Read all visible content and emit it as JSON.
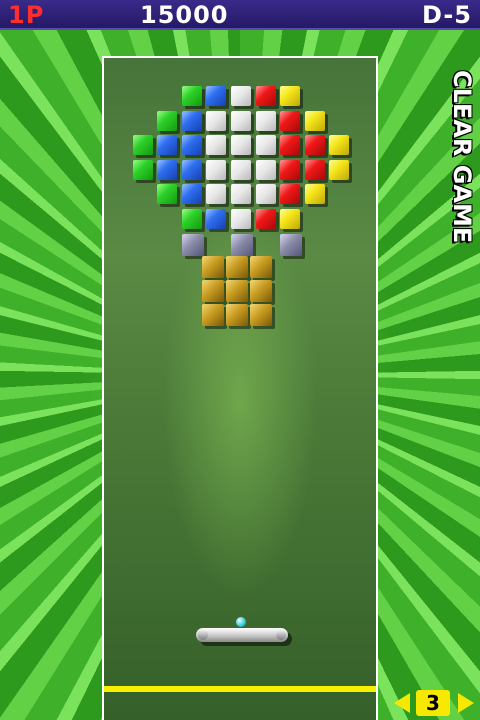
{
  "hud": {
    "player": "1P",
    "score": "15000",
    "stage": "D-5"
  },
  "side_menu": {
    "label": "CLEAR GAME"
  },
  "lives": {
    "count": "3"
  },
  "bricks": {
    "rows": [
      {
        "row": 0,
        "cells": [
          [
            3,
            "green"
          ],
          [
            4,
            "blue"
          ],
          [
            5,
            "white"
          ],
          [
            6,
            "red"
          ],
          [
            7,
            "yellow"
          ]
        ]
      },
      {
        "row": 1,
        "cells": [
          [
            2,
            "green"
          ],
          [
            3,
            "blue"
          ],
          [
            4,
            "white"
          ],
          [
            5,
            "white"
          ],
          [
            6,
            "white"
          ],
          [
            7,
            "red"
          ],
          [
            8,
            "yellow"
          ]
        ]
      },
      {
        "row": 2,
        "cells": [
          [
            1,
            "green"
          ],
          [
            2,
            "blue"
          ],
          [
            3,
            "blue"
          ],
          [
            4,
            "white"
          ],
          [
            5,
            "white"
          ],
          [
            6,
            "white"
          ],
          [
            7,
            "red"
          ],
          [
            8,
            "red"
          ],
          [
            9,
            "yellow"
          ]
        ]
      },
      {
        "row": 3,
        "cells": [
          [
            1,
            "green"
          ],
          [
            2,
            "blue"
          ],
          [
            3,
            "blue"
          ],
          [
            4,
            "white"
          ],
          [
            5,
            "white"
          ],
          [
            6,
            "white"
          ],
          [
            7,
            "red"
          ],
          [
            8,
            "red"
          ],
          [
            9,
            "yellow"
          ]
        ]
      },
      {
        "row": 4,
        "cells": [
          [
            2,
            "green"
          ],
          [
            3,
            "blue"
          ],
          [
            4,
            "white"
          ],
          [
            5,
            "white"
          ],
          [
            6,
            "white"
          ],
          [
            7,
            "red"
          ],
          [
            8,
            "yellow"
          ]
        ]
      },
      {
        "row": 5,
        "cells": [
          [
            3,
            "green"
          ],
          [
            4,
            "blue"
          ],
          [
            5,
            "white"
          ],
          [
            6,
            "red"
          ],
          [
            7,
            "yellow"
          ]
        ]
      },
      {
        "row": 6,
        "cells": [
          [
            3,
            "gray"
          ],
          [
            5,
            "gray"
          ],
          [
            7,
            "gray"
          ]
        ]
      }
    ],
    "basket": {
      "rows": 3,
      "cols": 3,
      "color": "gold"
    }
  },
  "colors": {
    "hud_bg": "#2a1e70",
    "player_label": "#ff2e2e",
    "barrier": "#f7f000",
    "arrow": "#f7e800"
  }
}
